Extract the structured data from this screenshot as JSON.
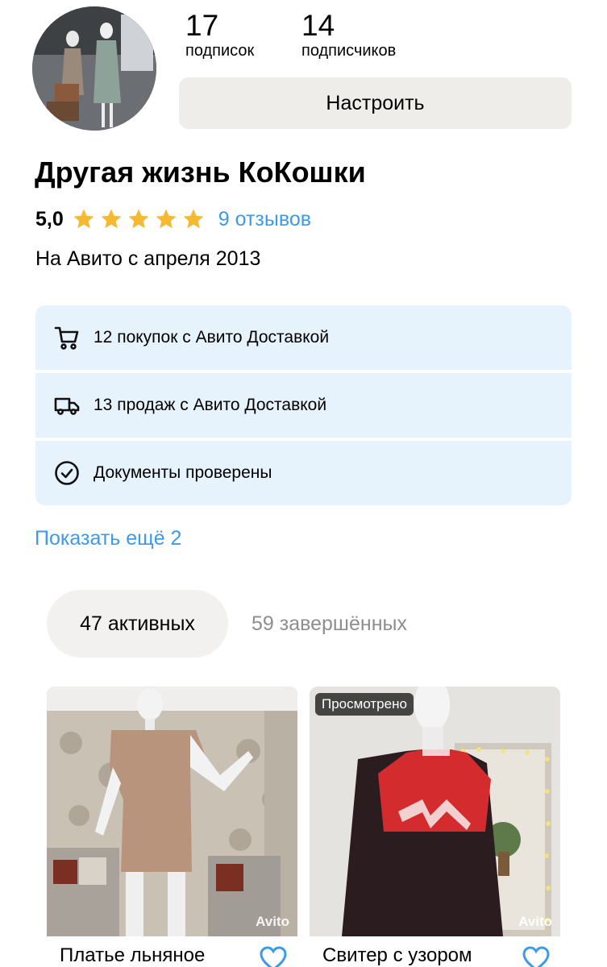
{
  "profile": {
    "following_count": "17",
    "following_label": "подписок",
    "followers_count": "14",
    "followers_label": "подписчиков",
    "configure_label": "Настроить",
    "shop_name": "Другая жизнь КоКошки",
    "rating": "5,0",
    "stars": 5,
    "reviews_label": "9 отзывов",
    "since": "На Авито с апреля 2013"
  },
  "badges": [
    {
      "icon": "cart-icon",
      "text": "12 покупок с Авито Доставкой"
    },
    {
      "icon": "truck-icon",
      "text": "13 продаж с Авито Доставкой"
    },
    {
      "icon": "check-circle-icon",
      "text": "Документы проверены"
    }
  ],
  "show_more_label": "Показать ещё 2",
  "tabs": {
    "active": "47 активных",
    "completed": "59 завершённых"
  },
  "listings": [
    {
      "title": "Платье льняное",
      "badge": "",
      "watermark": "Avito"
    },
    {
      "title": "Свитер с узором",
      "badge": "Просмотрено",
      "watermark": "Avito"
    }
  ],
  "colors": {
    "accent_link": "#3c9ae8",
    "star": "#f5b932",
    "badge_bg": "#e6f3fc",
    "button_bg": "#efede9"
  }
}
